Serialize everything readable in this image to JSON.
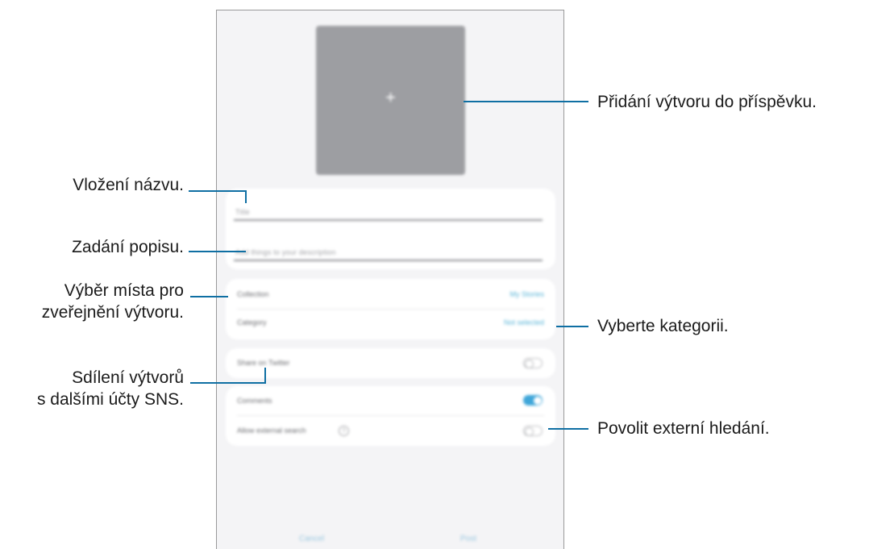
{
  "screen": {
    "add_button": "+",
    "title_field": {
      "placeholder": "Title"
    },
    "description_field": {
      "placeholder": "Add things to your description"
    },
    "collection_row": {
      "label": "Collection",
      "value": "My Stories"
    },
    "category_row": {
      "label": "Category",
      "value": "Not selected"
    },
    "share_row": {
      "label": "Share on Twitter",
      "toggle": "off"
    },
    "comments_row": {
      "label": "Comments",
      "toggle": "on"
    },
    "external_search_row": {
      "label": "Allow external search",
      "toggle": "off",
      "help_icon": "?"
    },
    "buttons": {
      "cancel": "Cancel",
      "post": "Post"
    }
  },
  "callouts": {
    "add_creation": "Přidání výtvoru do příspěvku.",
    "enter_title": "Vložení názvu.",
    "enter_description": "Zadání popisu.",
    "choose_place_line1": "Výběr místa pro",
    "choose_place_line2": "zveřejnění výtvoru.",
    "choose_category": "Vyberte kategorii.",
    "share_line1": "Sdílení výtvorů",
    "share_line2": "s dalšími účty SNS.",
    "allow_external": "Povolit externí hledání."
  },
  "colors": {
    "leader_line": "#0f6fa3",
    "accent_toggle": "#3fa6d9",
    "link_text": "#5ab5d8"
  }
}
